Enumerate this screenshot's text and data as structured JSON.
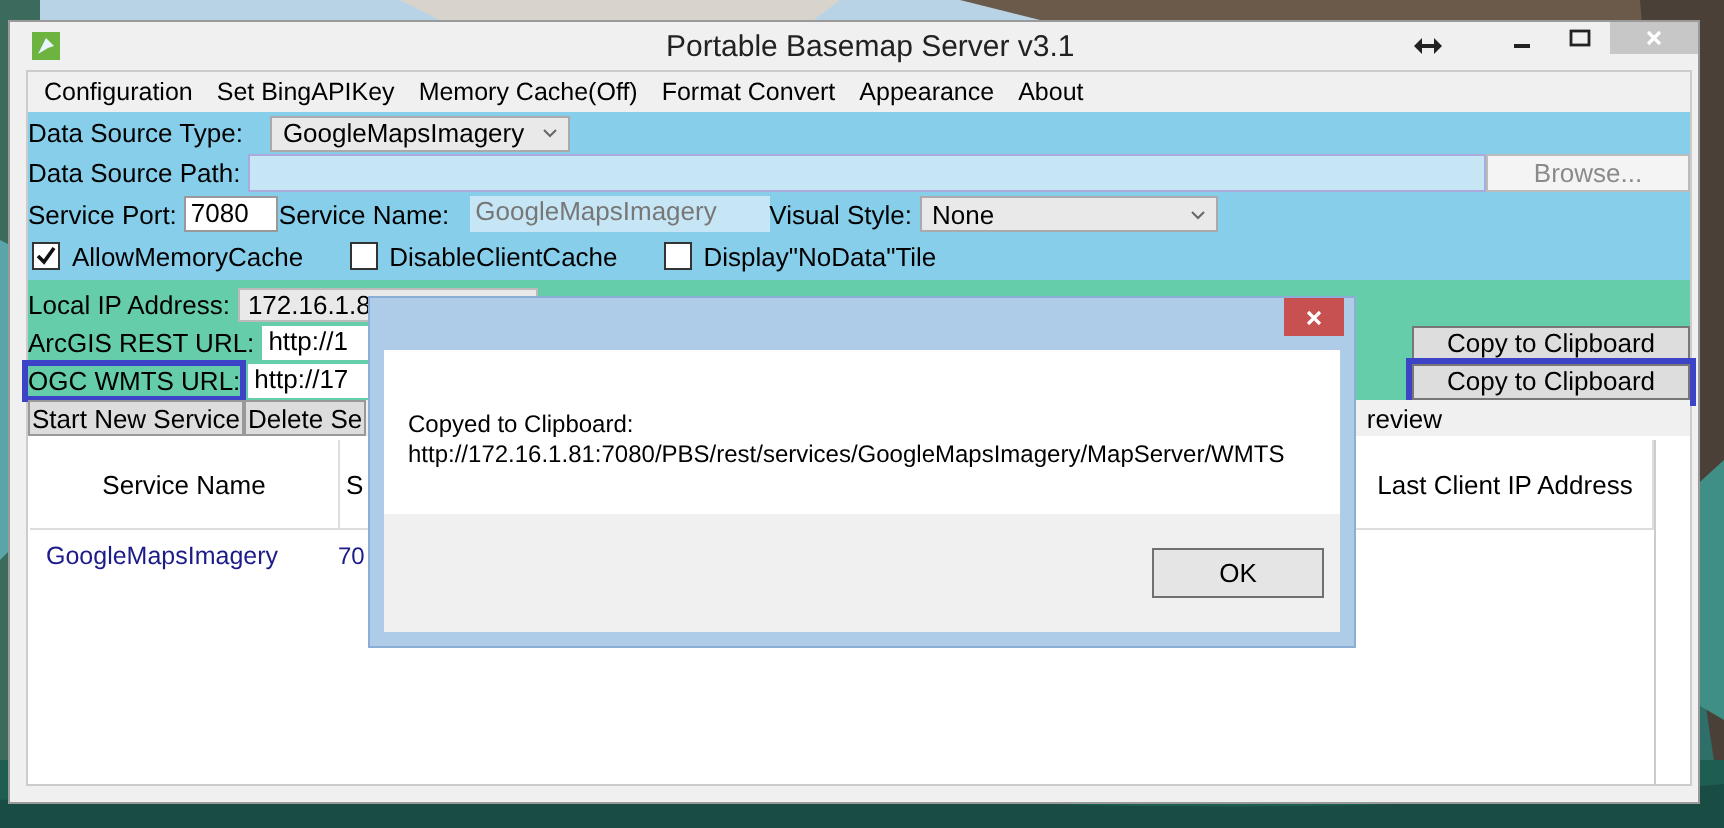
{
  "window": {
    "title": "Portable Basemap Server v3.1"
  },
  "menu": [
    {
      "label": "Configuration"
    },
    {
      "label": "Set BingAPIKey"
    },
    {
      "label": "Memory Cache(Off)"
    },
    {
      "label": "Format Convert"
    },
    {
      "label": "Appearance"
    },
    {
      "label": "About"
    }
  ],
  "data_source": {
    "type_label": "Data Source Type:",
    "type_value": "GoogleMapsImagery",
    "path_label": "Data Source Path:",
    "browse_button": "Browse...",
    "browse_disabled": true
  },
  "service": {
    "port_label": "Service Port:",
    "port_value": "7080",
    "name_label": "Service Name:",
    "name_value": "GoogleMapsImagery",
    "name_disabled": true,
    "style_label": "Visual Style:",
    "style_value": "None"
  },
  "options": [
    {
      "label": "AllowMemoryCache",
      "checked": true
    },
    {
      "label": "DisableClientCache",
      "checked": false
    },
    {
      "label": "Display\"NoData\"Tile",
      "checked": false
    }
  ],
  "addresses": {
    "ip_label": "Local IP Address:",
    "ip_value": "172.16.1.8",
    "rows": [
      {
        "label": "ArcGIS REST URL:",
        "value": "http://1",
        "button": "Copy to Clipboard",
        "highlighted": false
      },
      {
        "label": "OGC WMTS URL:",
        "value": "http://17",
        "button": "Copy to Clipboard",
        "highlighted": true
      }
    ]
  },
  "toolbar": [
    {
      "label": "Start New Service"
    },
    {
      "label": "Delete Se"
    },
    {
      "label": "review"
    }
  ],
  "table": {
    "columns": [
      "Service Name",
      "S",
      "Last Client IP Address"
    ],
    "rows": [
      {
        "cells": [
          "GoogleMapsImagery",
          "70"
        ]
      }
    ]
  },
  "dialog": {
    "lines": [
      "Copyed to Clipboard:",
      "http://172.16.1.81:7080/PBS/rest/services/GoogleMapsImagery/MapServer/WMTS"
    ],
    "button": "OK"
  }
}
